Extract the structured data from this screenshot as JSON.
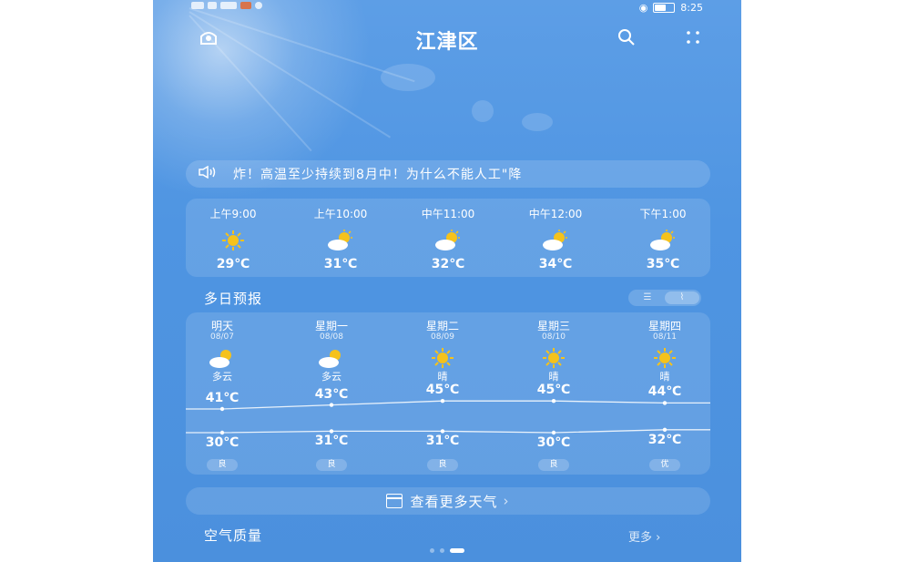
{
  "status": {
    "time": "8:25"
  },
  "header": {
    "city": "江津区"
  },
  "ticker": {
    "text": "炸！高温至少持续到8月中！为什么不能人工\"降"
  },
  "hourly": [
    {
      "time": "上午9:00",
      "icon": "sunny",
      "temp": "29℃"
    },
    {
      "time": "上午10:00",
      "icon": "partly-cloudy",
      "temp": "31℃"
    },
    {
      "time": "中午11:00",
      "icon": "partly-cloudy",
      "temp": "32℃"
    },
    {
      "time": "中午12:00",
      "icon": "partly-cloudy",
      "temp": "34℃"
    },
    {
      "time": "下午1:00",
      "icon": "partly-cloudy",
      "temp": "35℃"
    }
  ],
  "daily_section": {
    "title": "多日预报",
    "toggle_list": "☰",
    "toggle_chart": "⌇"
  },
  "daily": [
    {
      "name": "明天",
      "date": "08/07",
      "icon": "partly-cloudy",
      "cond": "多云",
      "high": "41℃",
      "low": "30℃",
      "aq": "良",
      "high_v": 41,
      "low_v": 30
    },
    {
      "name": "星期一",
      "date": "08/08",
      "icon": "partly-cloudy",
      "cond": "多云",
      "high": "43℃",
      "low": "31℃",
      "aq": "良",
      "high_v": 43,
      "low_v": 31
    },
    {
      "name": "星期二",
      "date": "08/09",
      "icon": "sunny",
      "cond": "晴",
      "high": "45℃",
      "low": "31℃",
      "aq": "良",
      "high_v": 45,
      "low_v": 31
    },
    {
      "name": "星期三",
      "date": "08/10",
      "icon": "sunny",
      "cond": "晴",
      "high": "45℃",
      "low": "30℃",
      "aq": "良",
      "high_v": 45,
      "low_v": 30
    },
    {
      "name": "星期四",
      "date": "08/11",
      "icon": "sunny",
      "cond": "晴",
      "high": "44℃",
      "low": "32℃",
      "aq": "优",
      "high_v": 44,
      "low_v": 32
    }
  ],
  "more_button": {
    "label": "查看更多天气"
  },
  "air_quality": {
    "title": "空气质量",
    "more": "更多 ›"
  },
  "colors": {
    "background": "#4f95e2",
    "sun": "#f5c21b",
    "cloud": "#ffffff"
  }
}
